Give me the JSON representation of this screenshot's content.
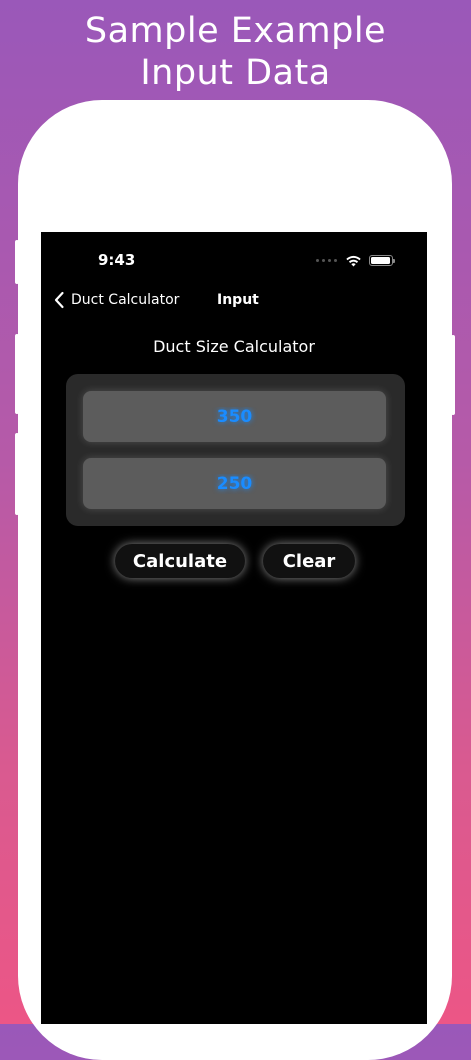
{
  "promo": {
    "title_line1": "Sample Example",
    "title_line2": "Input Data"
  },
  "status_bar": {
    "time": "9:43",
    "icons": [
      "cellular-dots-icon",
      "wifi-icon",
      "battery-icon"
    ]
  },
  "nav": {
    "back_label": "Duct Calculator",
    "title": "Input"
  },
  "calculator": {
    "heading": "Duct Size Calculator",
    "input1_value": "350",
    "input2_value": "250",
    "calculate_label": "Calculate",
    "clear_label": "Clear"
  },
  "colors": {
    "value_text": "#1a8cff",
    "screen_bg": "#000000",
    "gradient_top": "#9a58b9",
    "gradient_bottom": "#ec5686"
  }
}
